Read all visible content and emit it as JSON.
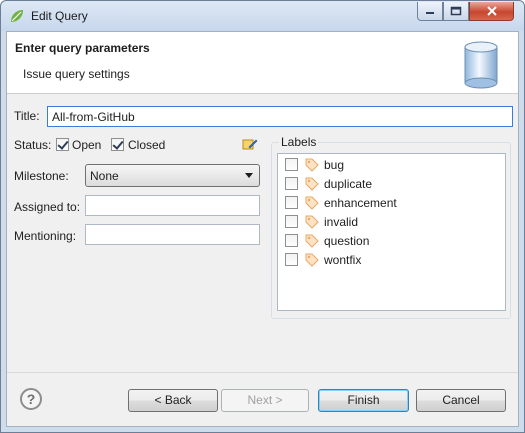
{
  "window": {
    "title": "Edit Query"
  },
  "header": {
    "title": "Enter query parameters",
    "subtitle": "Issue query settings"
  },
  "form": {
    "title_label": "Title:",
    "title_value": "All-from-GitHub",
    "status_label": "Status:",
    "status_open_label": "Open",
    "status_open_checked": true,
    "status_closed_label": "Closed",
    "status_closed_checked": true,
    "milestone_label": "Milestone:",
    "milestone_value": "None",
    "assigned_label": "Assigned to:",
    "assigned_value": "",
    "mentioning_label": "Mentioning:",
    "mentioning_value": ""
  },
  "labels": {
    "group_label": "Labels",
    "items": [
      {
        "name": "bug",
        "checked": false
      },
      {
        "name": "duplicate",
        "checked": false
      },
      {
        "name": "enhancement",
        "checked": false
      },
      {
        "name": "invalid",
        "checked": false
      },
      {
        "name": "question",
        "checked": false
      },
      {
        "name": "wontfix",
        "checked": false
      }
    ]
  },
  "footer": {
    "help": "?",
    "back": "< Back",
    "next": "Next >",
    "finish": "Finish",
    "cancel": "Cancel"
  },
  "colors": {
    "accent": "#3d7bdb",
    "close": "#c8462f",
    "tag": "#e8a864"
  }
}
